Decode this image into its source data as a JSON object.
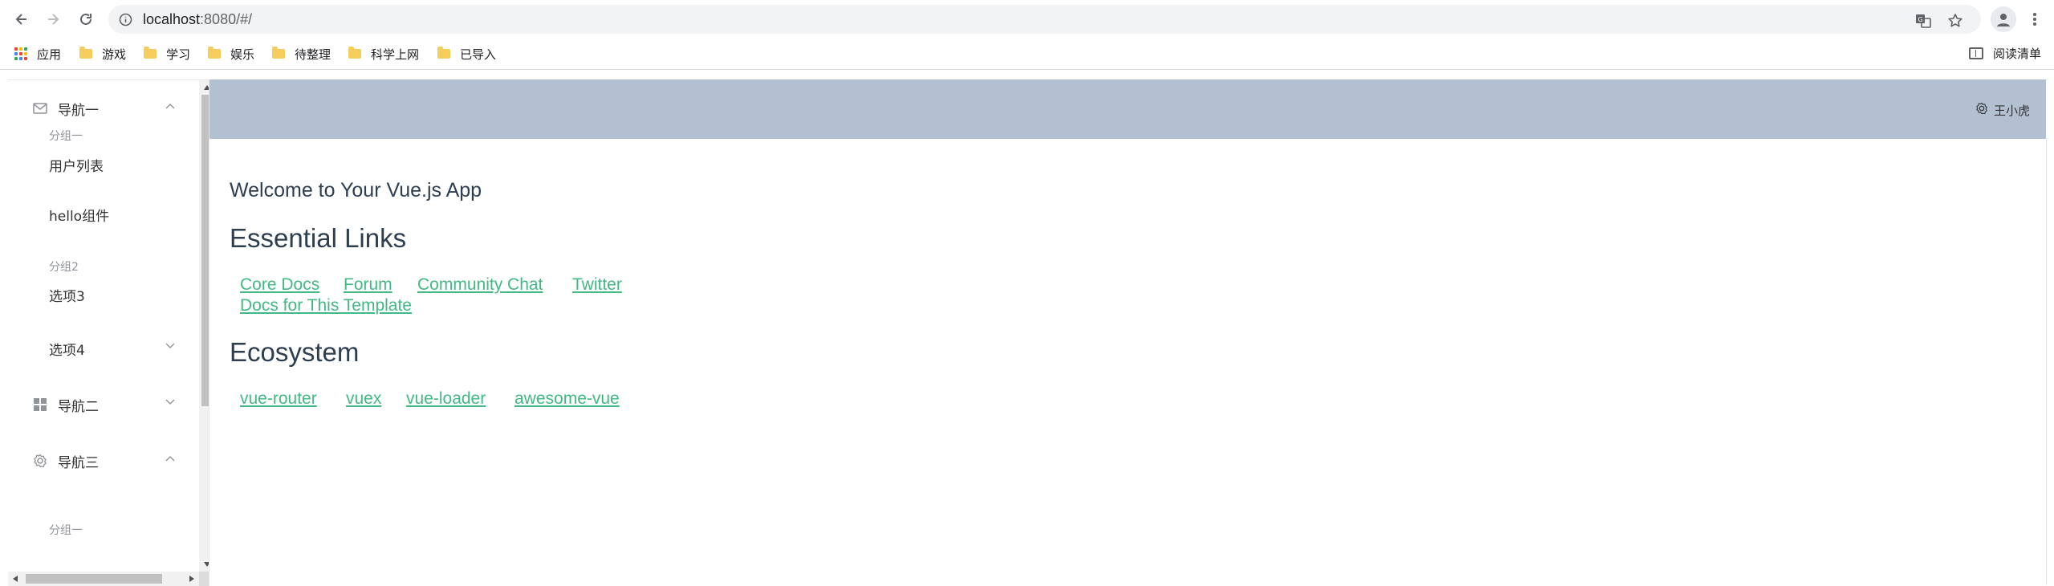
{
  "browser": {
    "url_host": "localhost",
    "url_rest": ":8080/#/",
    "bookmarks": [
      {
        "label": "应用",
        "icon": "apps-grid-icon"
      },
      {
        "label": "游戏",
        "icon": "folder-icon"
      },
      {
        "label": "学习",
        "icon": "folder-icon"
      },
      {
        "label": "娱乐",
        "icon": "folder-icon"
      },
      {
        "label": "待整理",
        "icon": "folder-icon"
      },
      {
        "label": "科学上网",
        "icon": "folder-icon"
      },
      {
        "label": "已导入",
        "icon": "folder-icon"
      }
    ],
    "reading_list": "阅读清单"
  },
  "sidebar": {
    "nav1": {
      "label": "导航一",
      "icon": "envelope-icon",
      "expanded": true
    },
    "group1": "分组一",
    "user_list": "用户列表",
    "hello": "hello组件",
    "group2": "分组2",
    "option3": "选项3",
    "option4": "选项4",
    "nav2": {
      "label": "导航二",
      "icon": "grid-icon",
      "expanded": false
    },
    "nav3": {
      "label": "导航三",
      "icon": "gear-icon",
      "expanded": true
    },
    "group3": "分组一"
  },
  "header": {
    "user": "王小虎",
    "bg_color": "#B3C0D1"
  },
  "main": {
    "welcome": "Welcome to Your Vue.js App",
    "essential_title": "Essential Links",
    "essential_links": [
      "Core Docs",
      "Forum",
      "Community Chat",
      "Twitter",
      "Docs for This Template"
    ],
    "ecosystem_title": "Ecosystem",
    "ecosystem_links": [
      "vue-router",
      "vuex",
      "vue-loader",
      "awesome-vue"
    ],
    "link_color": "#42B983"
  }
}
